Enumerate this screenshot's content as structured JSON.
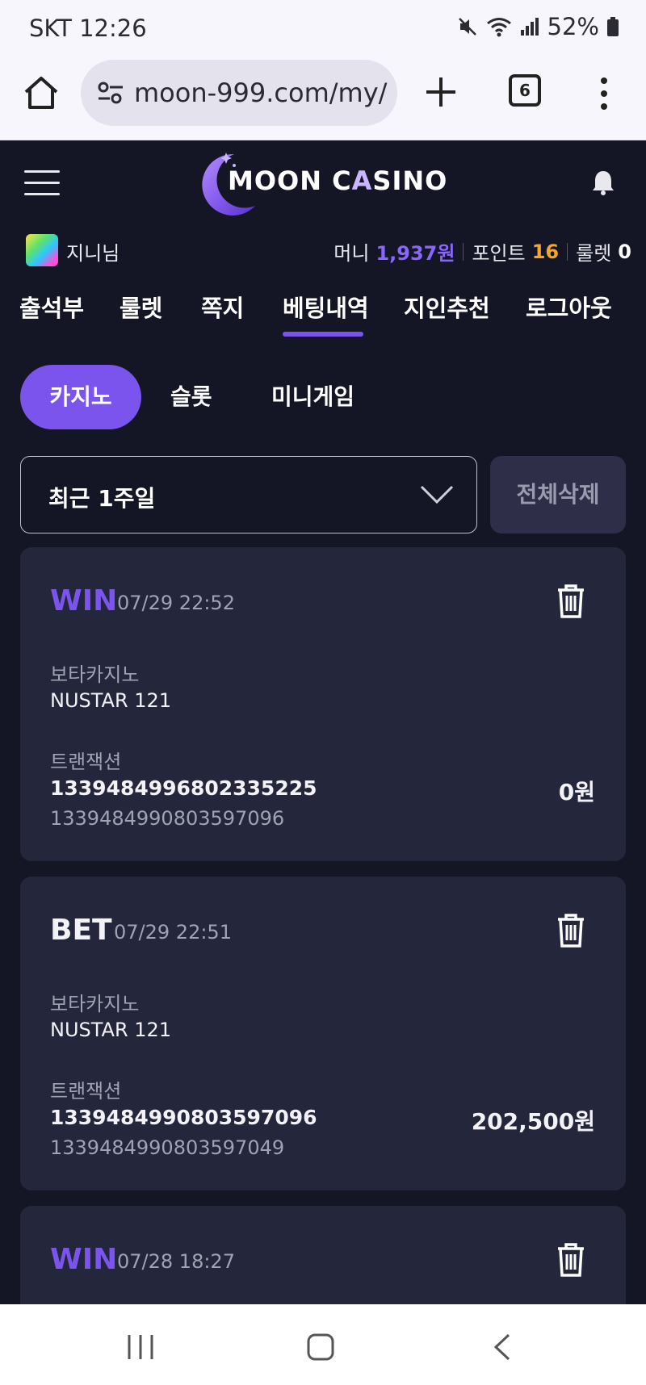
{
  "status_bar": {
    "carrier_time": "SKT 12:26",
    "battery": "52%"
  },
  "browser": {
    "url": "moon-999.com/my/",
    "tab_count": "6"
  },
  "site": {
    "logo_text_1": "MOON C",
    "logo_text_2": "A",
    "logo_text_3": "SINO"
  },
  "user": {
    "name": "지니님",
    "money_label": "머니",
    "money_value": "1,937원",
    "point_label": "포인트",
    "point_value": "16",
    "roulette_label": "룰렛",
    "roulette_value": "0"
  },
  "main_nav": {
    "items": [
      "출석부",
      "룰렛",
      "쪽지",
      "베팅내역",
      "지인추천",
      "로그아웃"
    ],
    "active": "베팅내역"
  },
  "sub_tabs": {
    "items": [
      "카지노",
      "슬롯",
      "미니게임"
    ],
    "active": "카지노"
  },
  "filter": {
    "period": "최근 1주일",
    "delete_all": "전체삭제"
  },
  "cards": [
    {
      "type": "WIN",
      "date": "07/29 22:52",
      "game_label": "보타카지노",
      "game_name": "NUSTAR 121",
      "tx_label": "트랜잭션",
      "tx_id": "1339484996802335225",
      "tx_ref": "1339484990803597096",
      "amount": "0원"
    },
    {
      "type": "BET",
      "date": "07/29 22:51",
      "game_label": "보타카지노",
      "game_name": "NUSTAR 121",
      "tx_label": "트랜잭션",
      "tx_id": "1339484990803597096",
      "tx_ref": "1339484990803597049",
      "amount": "202,500원"
    },
    {
      "type": "WIN",
      "date": "07/28 18:27"
    }
  ],
  "colors": {
    "accent": "#7b54ee",
    "background": "#151625",
    "card": "#24263c",
    "point": "#f5a623"
  }
}
